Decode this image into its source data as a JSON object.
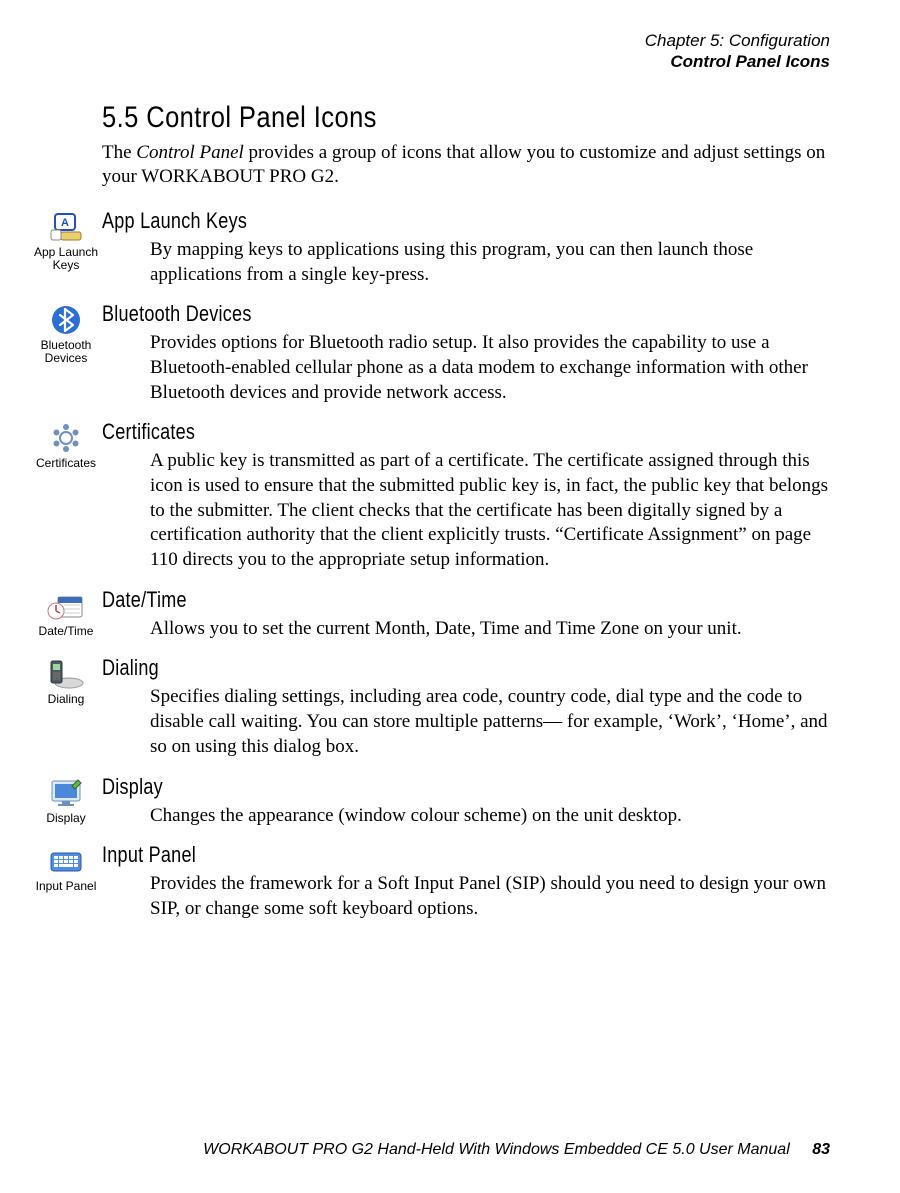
{
  "header": {
    "line1": "Chapter  5:  Configuration",
    "line2": "Control Panel Icons"
  },
  "section": {
    "number_title": "5.5   Control  Panel  Icons",
    "intro_html": "The <em>Control Panel</em> provides a group of icons that allow you to customize and adjust settings on your WORKABOUT PRO G2."
  },
  "items": [
    {
      "icon_label": "App Launch\nKeys",
      "title": "App Launch Keys",
      "body": "By mapping keys to applications using this program, you can then launch those applications from a single key-press."
    },
    {
      "icon_label": "Bluetooth\nDevices",
      "title": "Bluetooth Devices",
      "body": "Provides options for Bluetooth radio setup. It also provides the capability to use a Bluetooth-enabled cellular phone as a data modem to exchange information with other Bluetooth devices and provide network access."
    },
    {
      "icon_label": "Certificates",
      "title": "Certificates",
      "body": "A public key is transmitted as part of a certificate. The certificate assigned through this icon is used to ensure that the submitted public key is, in fact, the public key that belongs to the submitter. The client checks that the certificate has been digitally signed by a certification authority that the client explicitly trusts. “Certificate Assignment” on page 110 directs you to the appropriate setup information."
    },
    {
      "icon_label": "Date/Time",
      "title": "Date/Time",
      "body": "Allows you to set the current Month, Date, Time and Time Zone on your unit."
    },
    {
      "icon_label": "Dialing",
      "title": "Dialing",
      "body": "Specifies dialing settings, including area code, country code, dial type and the code to disable call waiting. You can store multiple patterns— for example, ‘Work’, ‘Home’, and so on using this dialog box."
    },
    {
      "icon_label": "Display",
      "title": "Display",
      "body": "Changes the appearance (window colour scheme) on the unit desktop."
    },
    {
      "icon_label": "Input Panel",
      "title": "Input Panel",
      "body": "Provides the framework for a Soft Input Panel (SIP) should you need to design your own SIP, or change some soft keyboard options."
    }
  ],
  "footer": {
    "text": "WORKABOUT PRO G2 Hand-Held With Windows Embedded CE 5.0 User Manual",
    "page": "83"
  }
}
